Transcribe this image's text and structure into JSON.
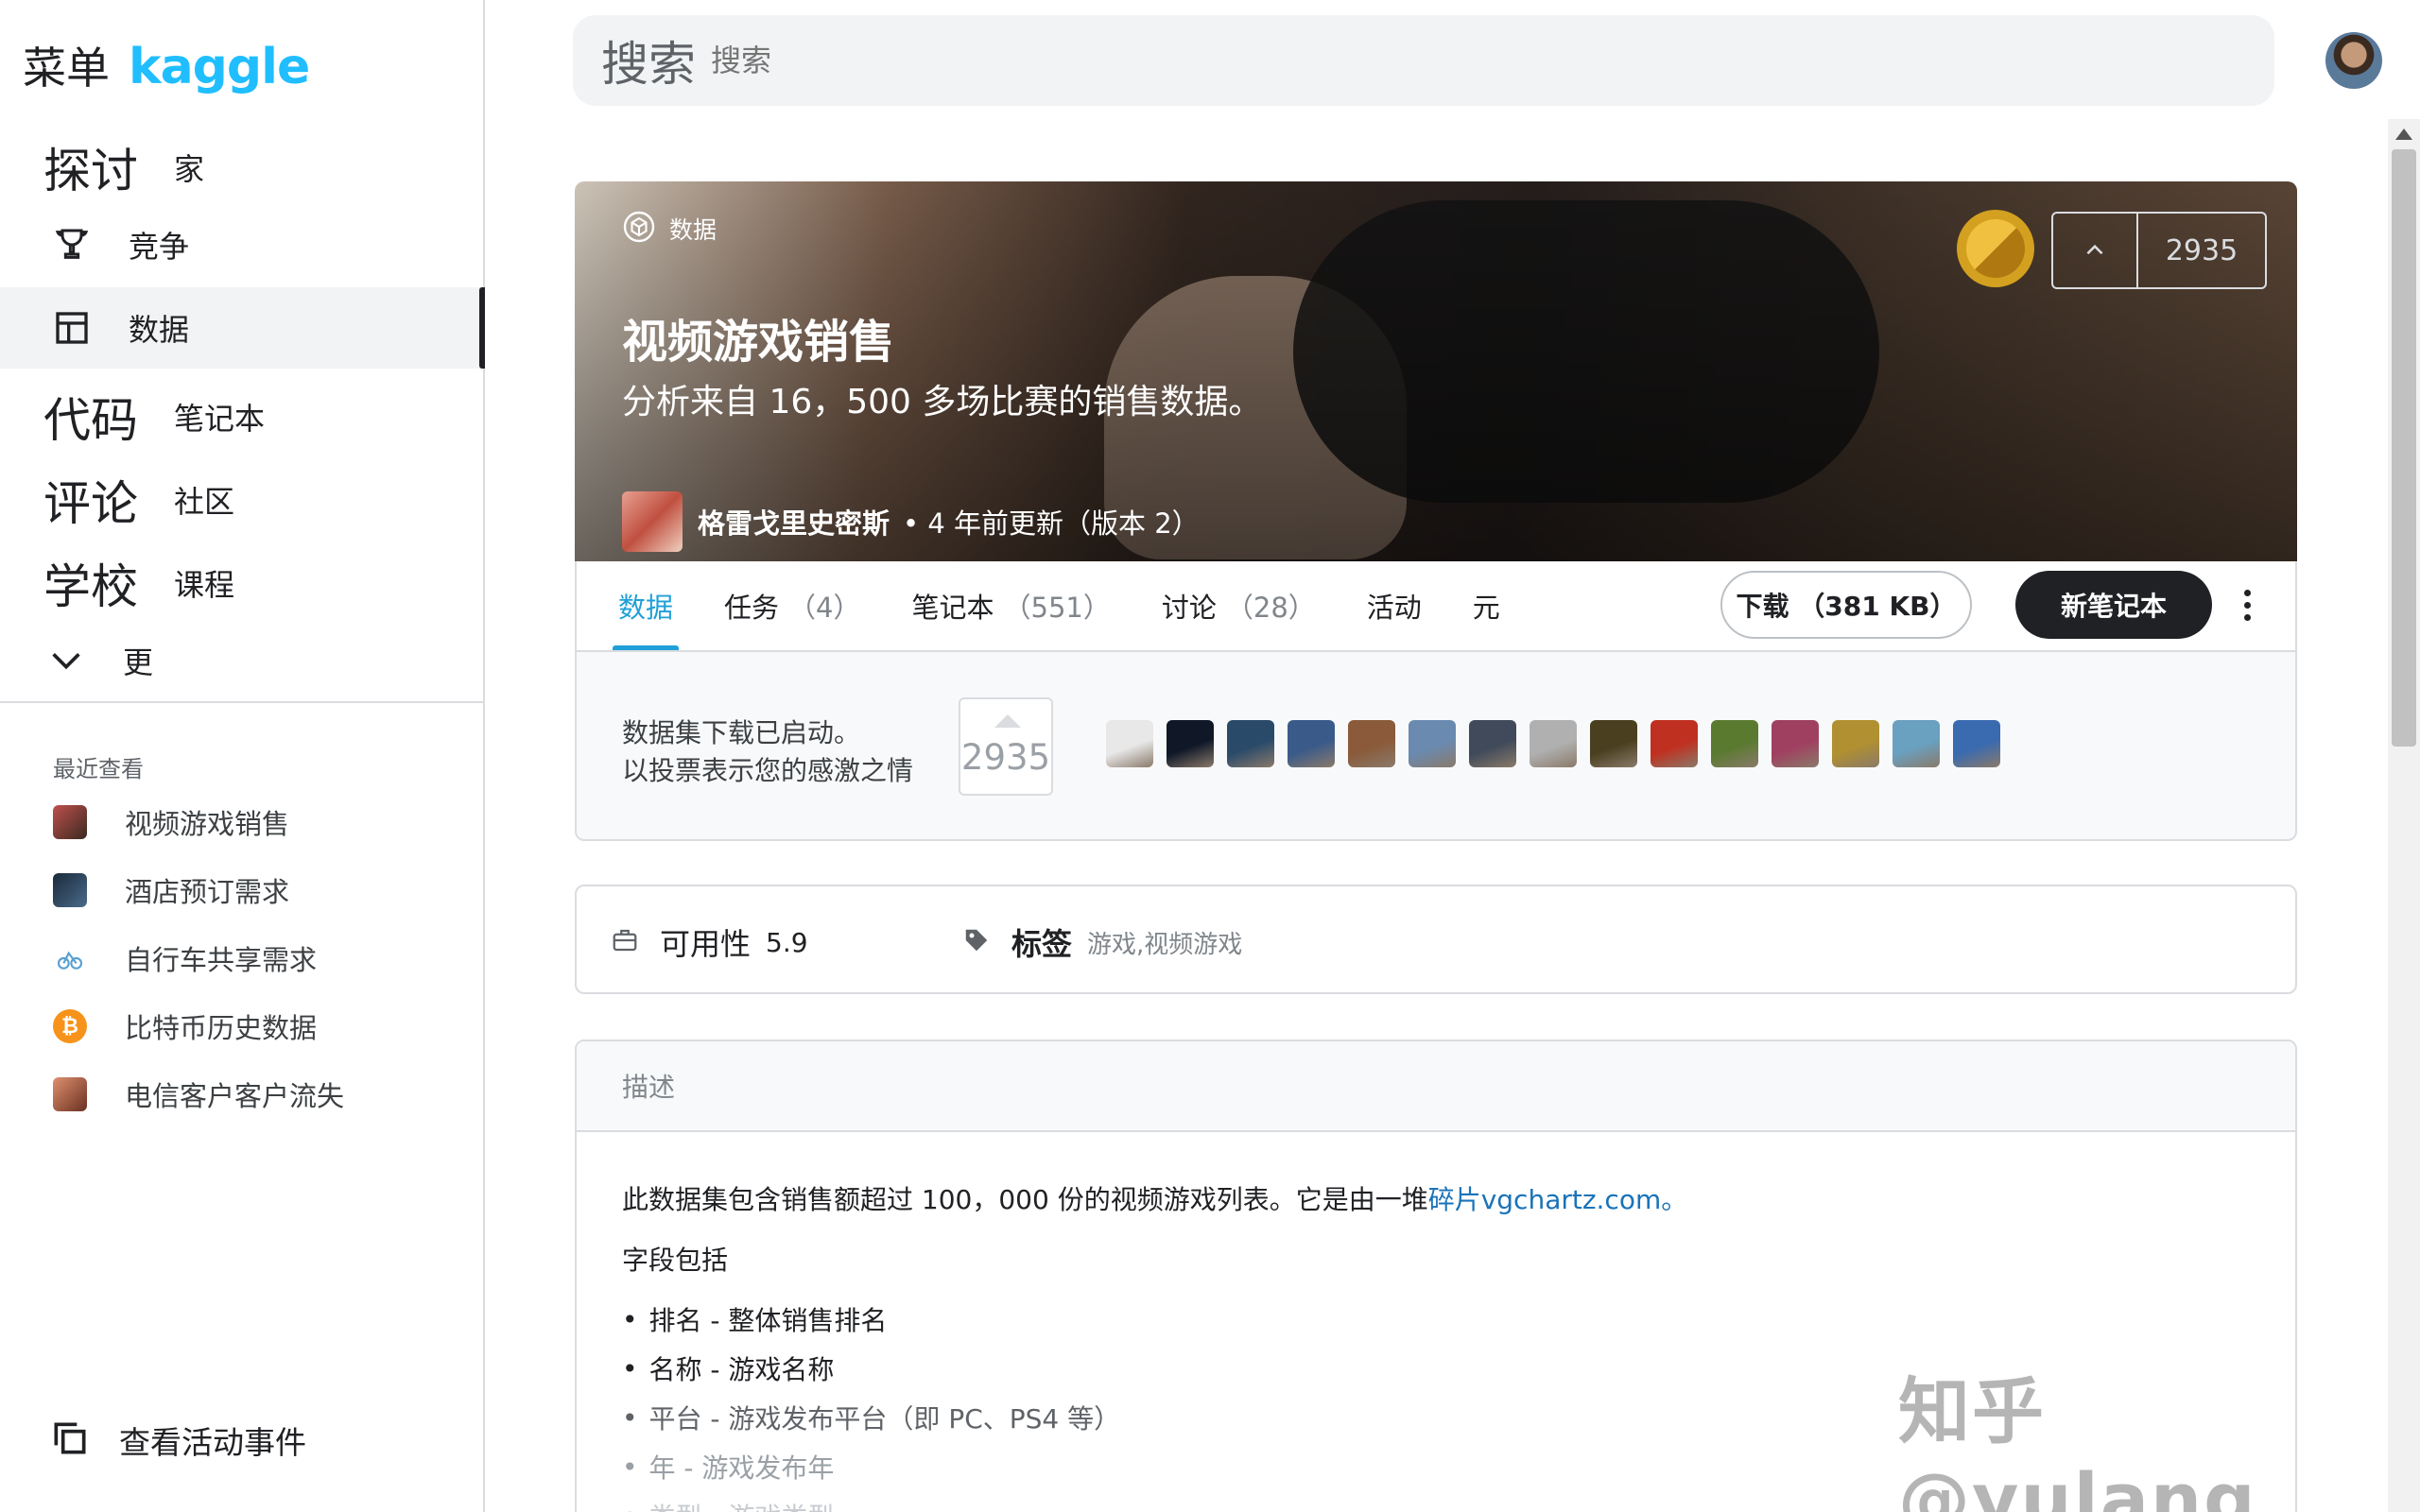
{
  "sidebar": {
    "menu_label": "菜单",
    "logo_text": "kaggle",
    "nav": [
      {
        "big": "探讨",
        "label": "家"
      },
      {
        "label": "竞争",
        "icon": "trophy-icon"
      },
      {
        "label": "数据",
        "icon": "table-icon",
        "active": true
      },
      {
        "big": "代码",
        "label": "笔记本"
      },
      {
        "big": "评论",
        "label": "社区"
      },
      {
        "big": "学校",
        "label": "课程"
      },
      {
        "label": "更",
        "icon": "chevron-down-icon"
      }
    ],
    "recent_title": "最近查看",
    "recent": [
      {
        "label": "视频游戏销售",
        "color": "#c0504d"
      },
      {
        "label": "酒店预订需求",
        "color": "#1a2a3a"
      },
      {
        "label": "自行车共享需求",
        "color": "#5aa0d0"
      },
      {
        "label": "比特币历史数据",
        "color": "#f7931a"
      },
      {
        "label": "电信客户客户流失",
        "color": "#c06040"
      }
    ],
    "events_label": "查看活动事件"
  },
  "search": {
    "label": "搜索",
    "placeholder": "搜索"
  },
  "dataset": {
    "type_label": "数据",
    "title": "视频游戏销售",
    "subtitle": "分析来自 16，500 多场比赛的销售数据。",
    "author": "格雷戈里史密斯",
    "updated": "• 4 年前更新（版本 2）",
    "votes": "2935"
  },
  "tabs": [
    {
      "label": "数据",
      "count": "",
      "active": true
    },
    {
      "label": "任务",
      "count": "（4）"
    },
    {
      "label": "笔记本",
      "count": "（551）"
    },
    {
      "label": "讨论",
      "count": "（28）"
    },
    {
      "label": "活动",
      "count": ""
    },
    {
      "label": "元",
      "count": ""
    }
  ],
  "actions": {
    "download_label": "下载 （381 KB）",
    "new_notebook_label": "新笔记本"
  },
  "notice": {
    "line1": "数据集下载已启动。",
    "line2": "以投票表示您的感激之情",
    "votes": "2935",
    "voter_colors": [
      "#e8e8e8",
      "#101828",
      "#2a4a6a",
      "#3a5a8a",
      "#8a5a3a",
      "#6a8ab0",
      "#404a5a",
      "#b0b0b0",
      "#4a4020",
      "#c03020",
      "#5a7a30",
      "#a04060",
      "#b09030",
      "#6aa0c0",
      "#3a6ab0"
    ]
  },
  "meta": {
    "usability_label": "可用性",
    "usability_value": "5.9",
    "tags_label": "标签",
    "tags_value": "游戏,视频游戏"
  },
  "description": {
    "header": "描述",
    "para_text": "此数据集包含销售额超过 100，000 份的视频游戏列表。它是由一堆",
    "para_link": "碎片vgchartz.com。",
    "fields_intro": "字段包括",
    "fields": [
      "排名 - 整体销售排名",
      "名称 - 游戏名称",
      "平台 - 游戏发布平台（即 PC、PS4 等）",
      "年 - 游戏发布年",
      "类型 - 游戏类型"
    ]
  },
  "watermark": "知乎 @yulang",
  "colors": {
    "accent": "#20a0d8",
    "kaggle_blue": "#20beff"
  }
}
